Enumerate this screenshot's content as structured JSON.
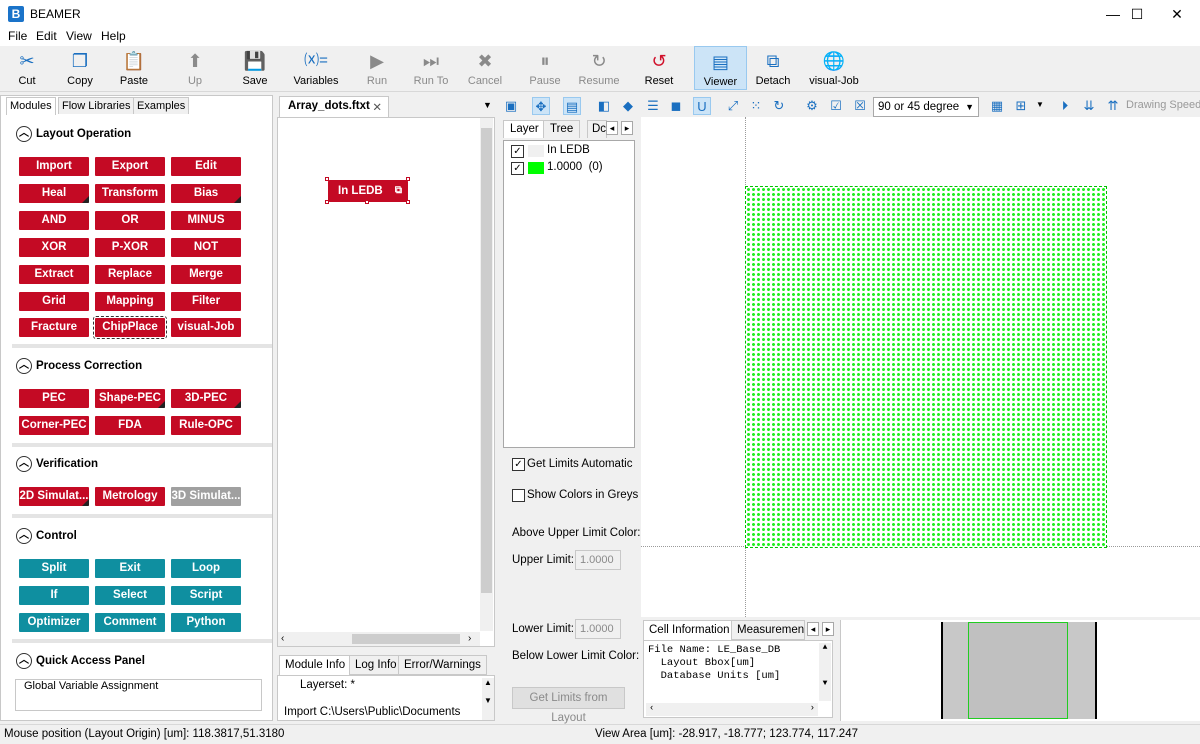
{
  "window": {
    "logo": "B",
    "title": "BEAMER",
    "controls": [
      "—",
      "☐",
      "✕"
    ]
  },
  "menu": [
    "File",
    "Edit",
    "View",
    "Help"
  ],
  "toolbar": {
    "buttons": [
      {
        "label": "Cut",
        "icon": "scissors-icon",
        "glyph": "✂",
        "enabled": true
      },
      {
        "label": "Copy",
        "icon": "copy-icon",
        "glyph": "❐",
        "enabled": true
      },
      {
        "label": "Paste",
        "icon": "paste-icon",
        "glyph": "📋",
        "enabled": true
      },
      {
        "label": "Up",
        "icon": "up-arrow-icon",
        "glyph": "⬆",
        "enabled": false
      },
      {
        "label": "Save",
        "icon": "save-icon",
        "glyph": "💾",
        "enabled": true
      },
      {
        "label": "Variables",
        "icon": "variables-icon",
        "glyph": "⒳=",
        "enabled": true
      },
      {
        "label": "Run",
        "icon": "play-icon",
        "glyph": "▶",
        "enabled": false
      },
      {
        "label": "Run To",
        "icon": "run-to-icon",
        "glyph": "⏭",
        "enabled": false
      },
      {
        "label": "Cancel",
        "icon": "cancel-icon",
        "glyph": "✖",
        "enabled": false
      },
      {
        "label": "Pause",
        "icon": "pause-icon",
        "glyph": "⏸",
        "enabled": false
      },
      {
        "label": "Resume",
        "icon": "resume-icon",
        "glyph": "↻",
        "enabled": false
      },
      {
        "label": "Reset",
        "icon": "reset-icon",
        "glyph": "↺",
        "enabled": true
      },
      {
        "label": "Viewer",
        "icon": "viewer-icon",
        "glyph": "▤",
        "enabled": true
      },
      {
        "label": "Detach",
        "icon": "detach-icon",
        "glyph": "⧉",
        "enabled": true
      },
      {
        "label": "visual-Job",
        "icon": "globe-icon",
        "glyph": "🌐",
        "enabled": true
      }
    ]
  },
  "left_panel": {
    "tabs": [
      "Modules",
      "Flow Libraries",
      "Examples"
    ],
    "sections": {
      "layout_operation": {
        "title": "Layout Operation",
        "modules": [
          "Import",
          "Export",
          "Edit",
          "Heal",
          "Transform",
          "Bias",
          "AND",
          "OR",
          "MINUS",
          "XOR",
          "P-XOR",
          "NOT",
          "Extract",
          "Replace",
          "Merge",
          "Grid",
          "Mapping",
          "Filter",
          "Fracture",
          "ChipPlace",
          "visual-Job"
        ]
      },
      "process_correction": {
        "title": "Process Correction",
        "modules": [
          "PEC",
          "Shape-PEC",
          "3D-PEC",
          "Corner-PEC",
          "FDA",
          "Rule-OPC"
        ]
      },
      "verification": {
        "title": "Verification",
        "modules": [
          "2D Simulat...",
          "Metrology",
          "3D Simulat..."
        ]
      },
      "control": {
        "title": "Control",
        "modules": [
          "Split",
          "Exit",
          "Loop",
          "If",
          "Select",
          "Script",
          "Optimizer",
          "Comment",
          "Python"
        ]
      },
      "quick_access": {
        "title": "Quick Access Panel",
        "group_label": "Global Variable Assignment"
      }
    }
  },
  "flow": {
    "tab_title": "Array_dots.ftxt",
    "tab_close": "✕",
    "node_label": "In LEDB"
  },
  "info_panel": {
    "tabs": [
      "Module Info",
      "Log Info",
      "Error/Warnings"
    ],
    "lines": [
      "Layerset: *",
      "Import C:\\Users\\Public\\Documents"
    ]
  },
  "layer_panel": {
    "tabs": [
      "Layer",
      "Tree",
      "Dc"
    ],
    "rows": [
      {
        "label": "In LEDB",
        "checked": true,
        "swatch": "#f0f0f0"
      },
      {
        "label": "1.0000  (0)",
        "checked": true,
        "swatch": "#00ff00"
      }
    ],
    "options": {
      "get_limits_automatic": {
        "label": "Get Limits Automatic",
        "checked": true
      },
      "show_colors_in_greys": {
        "label": "Show Colors in Greys",
        "checked": false
      }
    },
    "above_upper_limit_color": "Above Upper Limit Color:",
    "upper_limit_label": "Upper Limit:",
    "upper_limit_value": "1.0000",
    "lower_limit_label": "Lower Limit:",
    "lower_limit_value": "1.0000",
    "below_lower_limit_color": "Below Lower Limit Color:",
    "get_limits_button": "Get Limits from Layout"
  },
  "viewer": {
    "angle_select": "90 or 45 degree",
    "drawing_speed": "Drawing Speed",
    "dot_color": "#22ee22"
  },
  "cell_info": {
    "tabs": [
      "Cell Information",
      "Measurement"
    ],
    "lines": [
      "File Name: LE_Base_DB",
      "  Layout Bbox[um]",
      "  Database Units [um]"
    ]
  },
  "status": {
    "mouse_position": "Mouse position (Layout Origin) [um]: 118.3817,51.3180",
    "view_area": "View Area [um]: -28.917, -18.777; 123.774, 117.247"
  }
}
